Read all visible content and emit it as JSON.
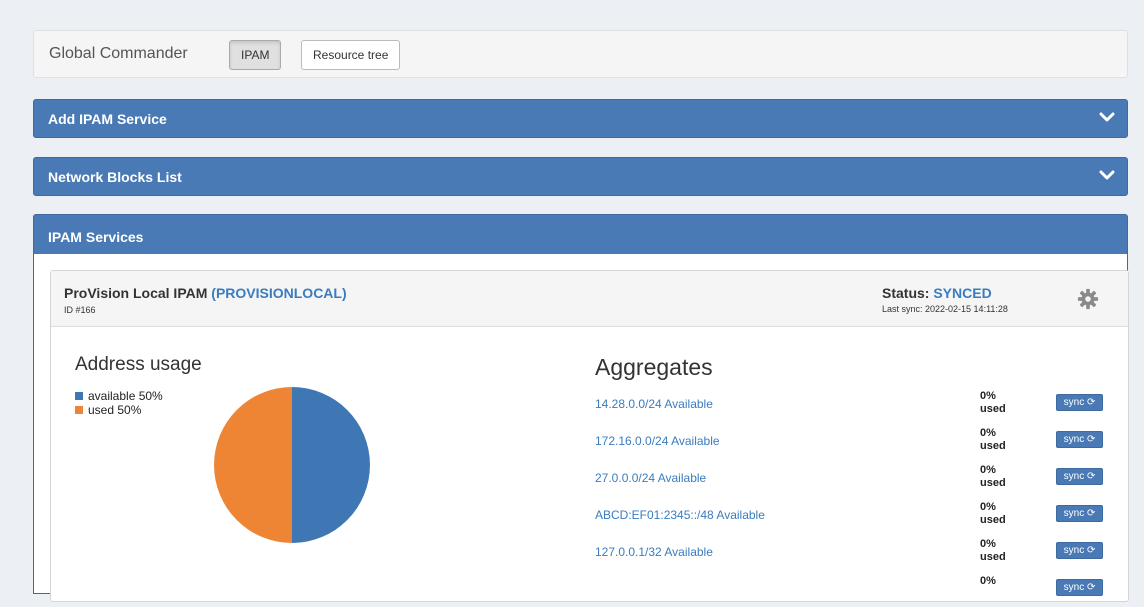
{
  "header": {
    "title": "Global Commander",
    "tabs": [
      {
        "label": "IPAM",
        "active": true
      },
      {
        "label": "Resource tree",
        "active": false
      }
    ]
  },
  "panels": {
    "add_service": "Add IPAM Service",
    "network_blocks": "Network Blocks List",
    "services": "IPAM Services"
  },
  "service": {
    "name": "ProVision Local IPAM",
    "code": "(PROVISIONLOCAL)",
    "id": "ID #166",
    "status_label": "Status:",
    "status_value": "SYNCED",
    "last_sync": "Last sync: 2022-02-15 14:11:28"
  },
  "usage": {
    "title": "Address usage",
    "legend": [
      {
        "label": "available 50%",
        "color": "#3f76b4"
      },
      {
        "label": "used 50%",
        "color": "#ee8535"
      }
    ]
  },
  "chart_data": {
    "type": "pie",
    "labels": [
      "available",
      "used"
    ],
    "values": [
      50,
      50
    ],
    "colors": [
      "#3f76b4",
      "#ee8535"
    ]
  },
  "aggregates": {
    "title": "Aggregates",
    "sync_label": "sync ⟳",
    "rows": [
      {
        "link": "14.28.0.0/24 Available",
        "pct": "0%",
        "used": "used"
      },
      {
        "link": "172.16.0.0/24 Available",
        "pct": "0%",
        "used": "used"
      },
      {
        "link": "27.0.0.0/24 Available",
        "pct": "0%",
        "used": "used"
      },
      {
        "link": "ABCD:EF01:2345::/48 Available",
        "pct": "0%",
        "used": "used"
      },
      {
        "link": "127.0.0.1/32 Available",
        "pct": "0%",
        "used": "used"
      },
      {
        "link": "",
        "pct": "0%",
        "used": ""
      }
    ]
  },
  "colors": {
    "accent": "#4a7ab5",
    "link": "#3a7cc0"
  }
}
